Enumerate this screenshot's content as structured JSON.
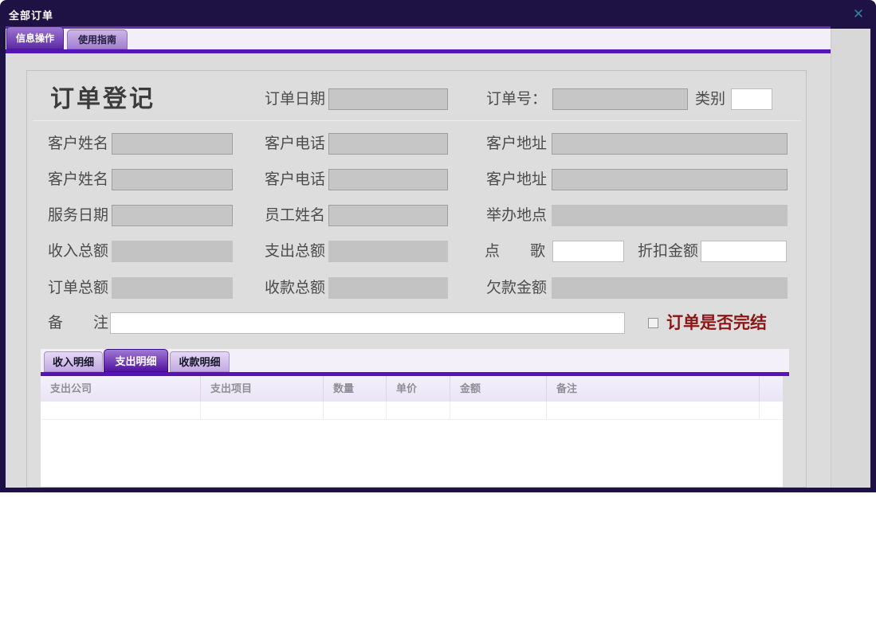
{
  "window": {
    "title": "全部订单",
    "close_glyph": "✕"
  },
  "main_tabs": {
    "info": "信息操作",
    "guide": "使用指南"
  },
  "form": {
    "title": "订单登记",
    "labels": {
      "order_date": "订单日期",
      "order_no": "订单号：",
      "category": "类别",
      "customer_name": "客户姓名",
      "customer_phone": "客户电话",
      "customer_address": "客户地址",
      "customer_name2": "客户姓名",
      "customer_phone2": "客户电话",
      "customer_address2": "客户地址",
      "service_date": "服务日期",
      "staff_name": "员工姓名",
      "venue": "举办地点",
      "income_total": "收入总额",
      "expense_total": "支出总额",
      "song": "点　　歌",
      "discount": "折扣金额",
      "order_total": "订单总额",
      "received_total": "收款总额",
      "debt": "欠款金额",
      "remark": "备　　注"
    },
    "values": {
      "order_date": "",
      "order_no": "",
      "category": "",
      "customer_name": "",
      "customer_phone": "",
      "customer_address": "",
      "customer_name2": "",
      "customer_phone2": "",
      "customer_address2": "",
      "service_date": "",
      "staff_name": "",
      "venue": "",
      "income_total": "",
      "expense_total": "",
      "song": "",
      "discount": "",
      "order_total": "",
      "received_total": "",
      "debt": "",
      "remark": ""
    },
    "finish_checkbox": {
      "label": "订单是否完结",
      "checked": false
    }
  },
  "detail_tabs": {
    "income": "收入明细",
    "expense": "支出明细",
    "payment": "收款明细",
    "active": "支出明细"
  },
  "detail_table": {
    "headers": [
      "支出公司",
      "支出项目",
      "数量",
      "单价",
      "金额",
      "备注"
    ],
    "rows": []
  },
  "colors": {
    "titlebar": "#1d1243",
    "accent_purple": "#5513b9",
    "active_tab_purple": "#5d2ba6",
    "panel_gray": "#dddddd",
    "disabled_input_gray": "#c6c6c6",
    "warning_red": "#8c1616",
    "close_teal": "#2f8299"
  }
}
